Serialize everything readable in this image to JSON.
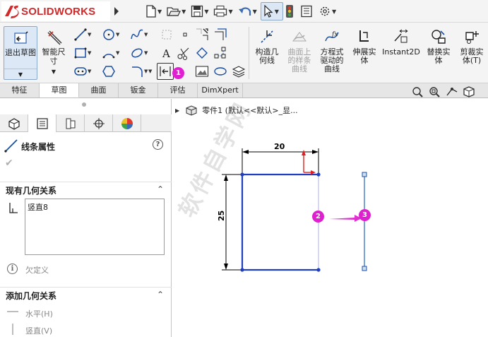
{
  "app": {
    "logo_text": "SOLIDWORKS"
  },
  "title_toolbar": {
    "icons": [
      "new-document-icon",
      "open-folder-icon",
      "save-icon",
      "print-icon",
      "undo-icon",
      "select-cursor-icon",
      "traffic-light-icon",
      "file-properties-icon",
      "options-gear-icon"
    ]
  },
  "command_manager": {
    "exit_sketch_label": "退出草图",
    "smart_dimension_label": "智能尺寸",
    "big_buttons": [
      {
        "id": "convert",
        "label": "构造几\n何线",
        "disabled": false
      },
      {
        "id": "intersection",
        "label": "曲面上\n的样条\n曲线",
        "disabled": true
      },
      {
        "id": "equation",
        "label": "方程式\n驱动的\n曲线",
        "disabled": false
      },
      {
        "id": "extrude",
        "label": "伸展实\n体",
        "disabled": false
      },
      {
        "id": "instant2d",
        "label": "Instant2D",
        "disabled": false
      },
      {
        "id": "replace",
        "label": "替换实\n体",
        "disabled": false
      },
      {
        "id": "trim",
        "label": "剪裁实\n体(T)",
        "disabled": false
      }
    ],
    "badge_1": "1"
  },
  "tabs": [
    {
      "label": "特征",
      "active": false
    },
    {
      "label": "草图",
      "active": true
    },
    {
      "label": "曲面",
      "active": false
    },
    {
      "label": "钣金",
      "active": false
    },
    {
      "label": "评估",
      "active": false
    },
    {
      "label": "DimXpert",
      "active": false
    }
  ],
  "property_manager": {
    "title": "线条属性",
    "help_symbol": "?",
    "ok_symbol": "✔",
    "existing_relations": {
      "header": "现有几何关系",
      "items": [
        "竖直8"
      ]
    },
    "status": "欠定义",
    "info_symbol": "i",
    "add_relations": {
      "header": "添加几何关系",
      "items": [
        "水平(H)",
        "竖直(V)"
      ]
    }
  },
  "graphics": {
    "tree_label": "零件1  (默认<<默认>_显...",
    "dimensions": {
      "horizontal": "20",
      "vertical": "25"
    },
    "badges": [
      "2",
      "3"
    ],
    "watermark": "软件自学网"
  },
  "colors": {
    "accent_pink": "#e020d0",
    "sketch_blue": "#1f3fbf",
    "selected_line": "#4a86c9",
    "dimension_red": "#e02020"
  }
}
